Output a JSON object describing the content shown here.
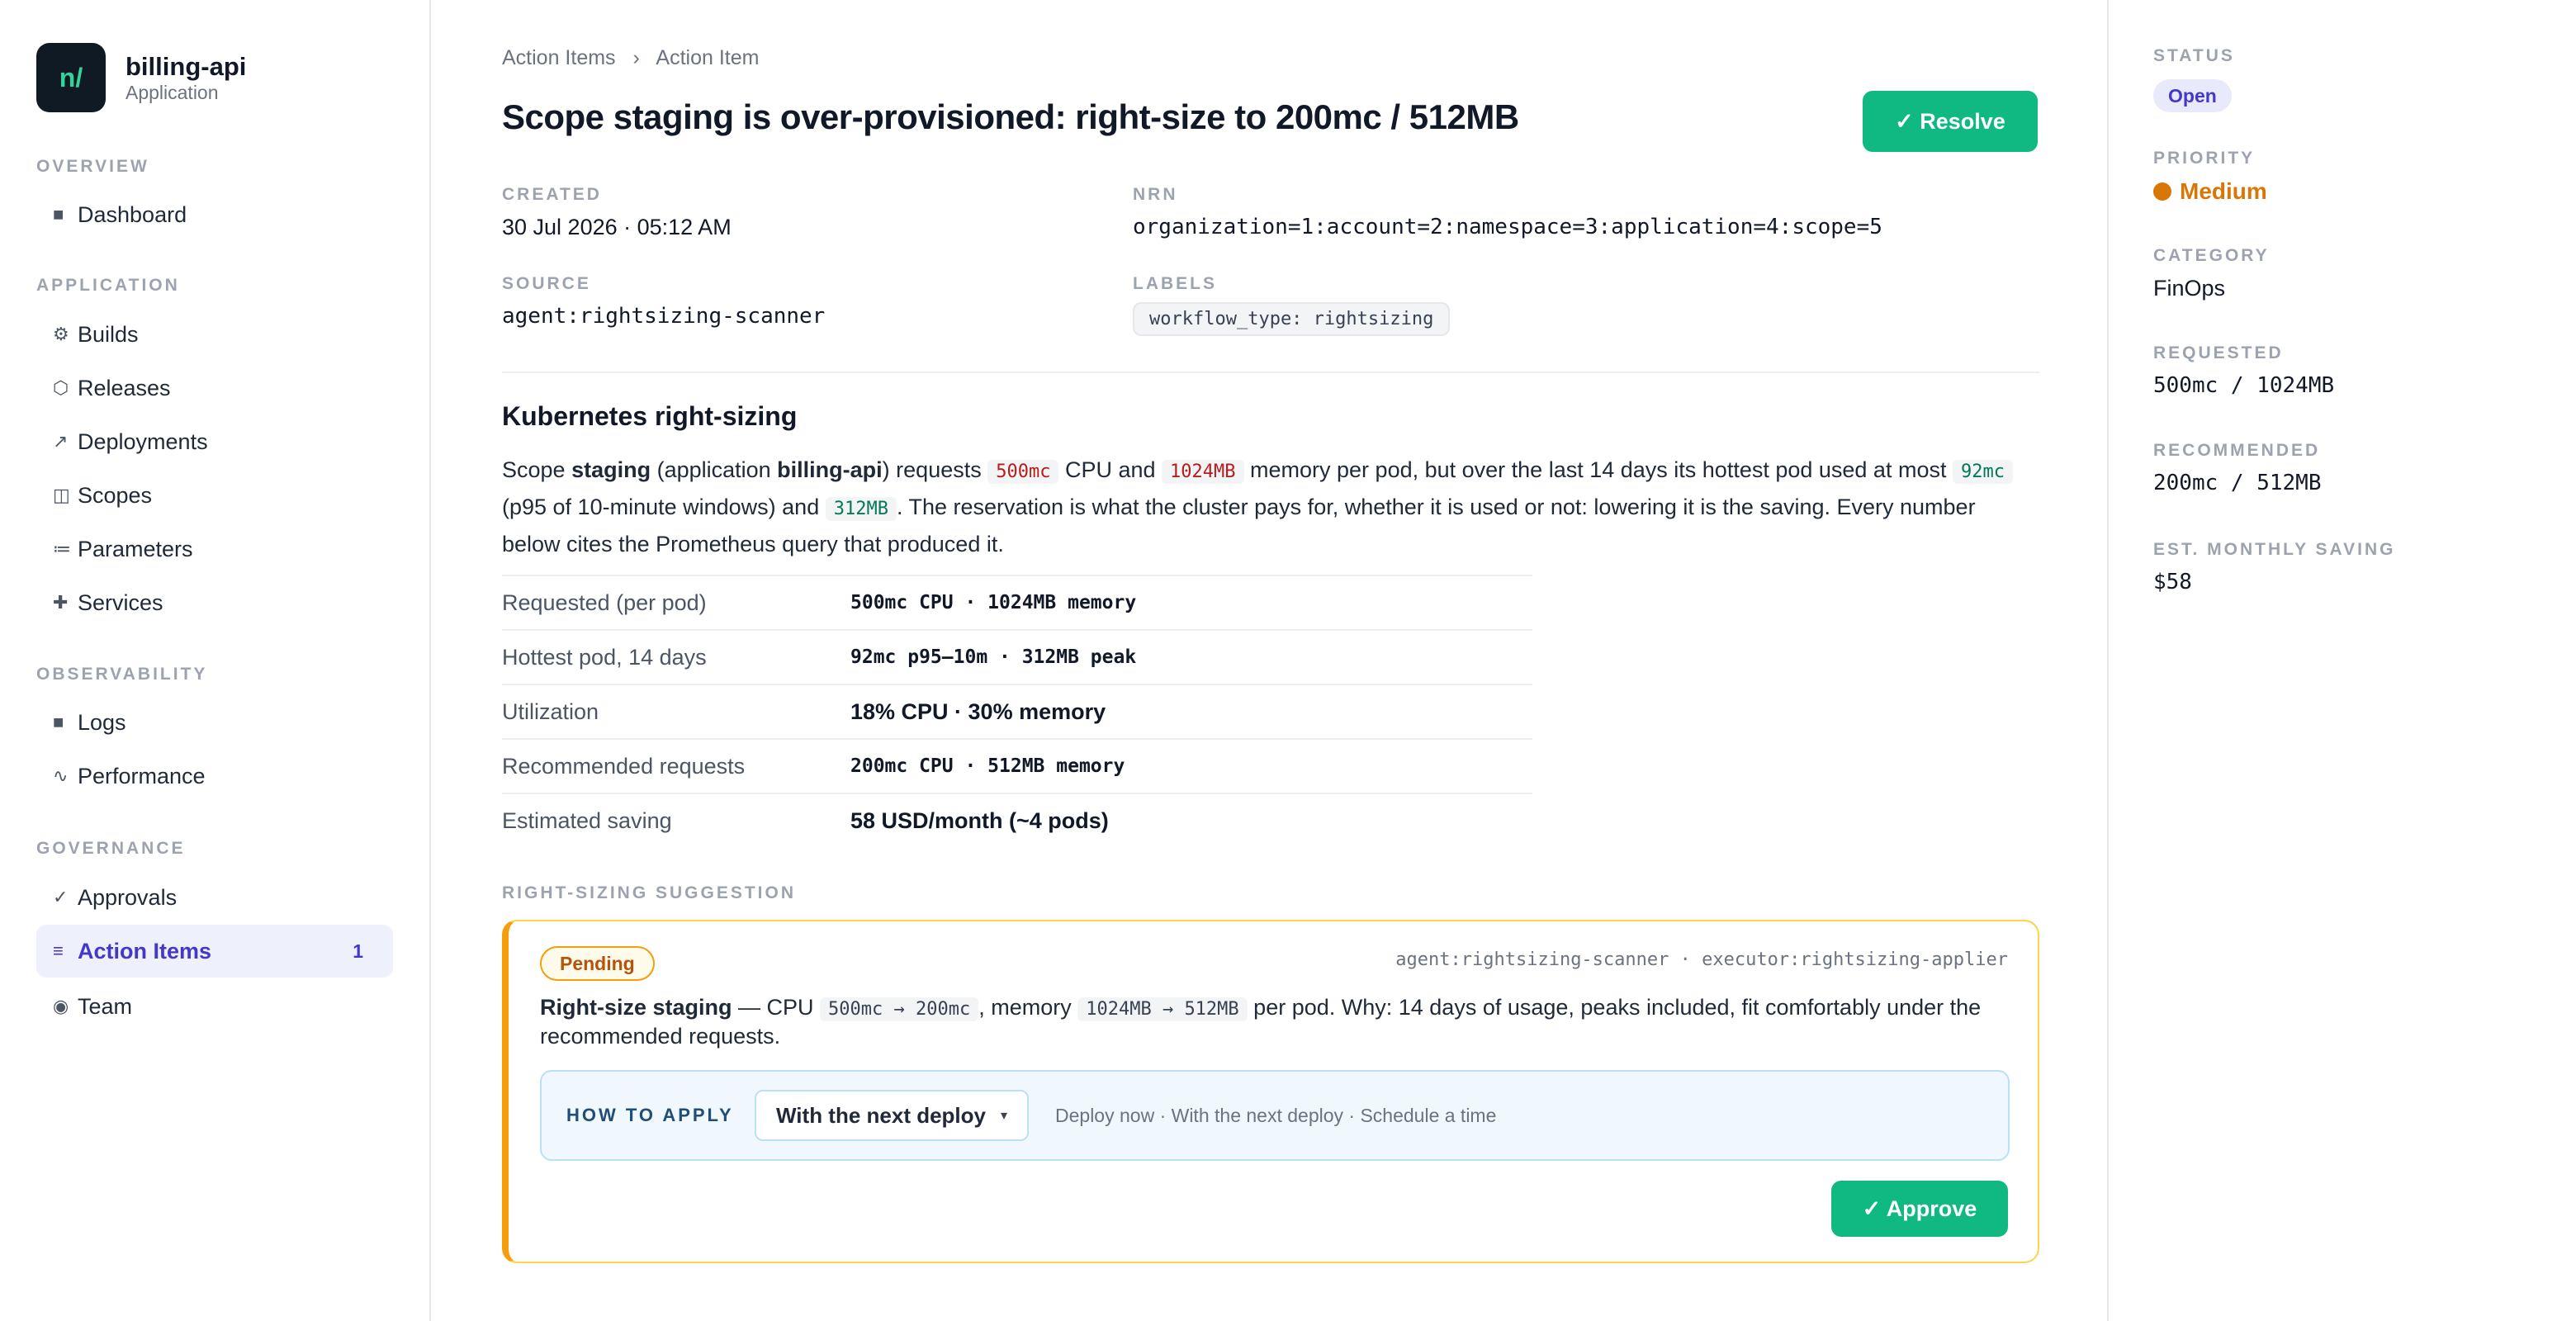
{
  "app": {
    "logo_text": "n/",
    "name": "billing-api",
    "type": "Application"
  },
  "sidebar": {
    "sections": [
      {
        "title": "OVERVIEW",
        "items": [
          {
            "icon": "square-icon",
            "glyph": "■",
            "label": "Dashboard"
          }
        ]
      },
      {
        "title": "APPLICATION",
        "items": [
          {
            "icon": "gear-icon",
            "glyph": "⚙",
            "label": "Builds"
          },
          {
            "icon": "hexagon-icon",
            "glyph": "⬡",
            "label": "Releases"
          },
          {
            "icon": "arrow-up-right-icon",
            "glyph": "↗",
            "label": "Deployments"
          },
          {
            "icon": "scopes-icon",
            "glyph": "◫",
            "label": "Scopes"
          },
          {
            "icon": "list-icon",
            "glyph": "≔",
            "label": "Parameters"
          },
          {
            "icon": "plus-icon",
            "glyph": "✚",
            "label": "Services"
          }
        ]
      },
      {
        "title": "OBSERVABILITY",
        "items": [
          {
            "icon": "square-icon",
            "glyph": "■",
            "label": "Logs"
          },
          {
            "icon": "wave-icon",
            "glyph": "∿",
            "label": "Performance"
          }
        ]
      },
      {
        "title": "GOVERNANCE",
        "items": [
          {
            "icon": "check-icon",
            "glyph": "✓",
            "label": "Approvals"
          },
          {
            "icon": "list-icon",
            "glyph": "≡",
            "label": "Action Items",
            "count": "1",
            "active": true
          },
          {
            "icon": "team-icon",
            "glyph": "◉",
            "label": "Team"
          }
        ]
      }
    ]
  },
  "breadcrumb": {
    "parent": "Action Items",
    "separator": "›",
    "current": "Action Item"
  },
  "page": {
    "title": "Scope staging is over-provisioned: right-size to 200mc / 512MB",
    "resolve_label": "✓ Resolve"
  },
  "meta": {
    "created_label": "CREATED",
    "created_value": "30 Jul 2026 · 05:12 AM",
    "nrn_label": "NRN",
    "nrn_value": "organization=1:account=2:namespace=3:application=4:scope=5",
    "source_label": "SOURCE",
    "source_value": "agent:rightsizing-scanner",
    "labels_label": "LABELS",
    "labels_value": "workflow_type: rightsizing"
  },
  "details": {
    "heading": "Kubernetes right-sizing",
    "p_1": "Scope ",
    "p_scope": "staging",
    "p_2": " (application ",
    "p_app": "billing-api",
    "p_3": ") requests ",
    "p_cpu_req": "500mc",
    "p_4": " CPU and ",
    "p_mem_req": "1024MB",
    "p_5": " memory per pod, but over the last 14 days its hottest pod used at most ",
    "p_cpu_used": "92mc",
    "p_6": " (p95 of 10-minute windows) and ",
    "p_mem_used": "312MB",
    "p_7": ". The reservation is what the cluster pays for, whether it is used or not: lowering it is the saving. Every number below cites the Prometheus query that produced it.",
    "rows": [
      {
        "key": "Requested (per pod)",
        "value": "500mc CPU · 1024MB memory",
        "mono": true
      },
      {
        "key": "Hottest pod, 14 days",
        "value": "92mc p95–10m · 312MB peak",
        "mono": true
      },
      {
        "key": "Utilization",
        "value": "18% CPU · 30% memory",
        "mono": false
      },
      {
        "key": "Recommended requests",
        "value": "200mc CPU · 512MB memory",
        "mono": true
      },
      {
        "key": "Estimated saving",
        "value": "58 USD/month (~4 pods)",
        "mono": false
      }
    ]
  },
  "suggestion": {
    "section_label": "RIGHT-SIZING SUGGESTION",
    "status": "Pending",
    "agents": "agent:rightsizing-scanner · executor:rightsizing-applier",
    "t_title": "Right-size staging",
    "t_1": " — CPU ",
    "t_cpu": "500mc → 200mc",
    "t_2": ", memory ",
    "t_mem": "1024MB → 512MB",
    "t_3": " per pod. Why: 14 days of usage, peaks included, fit comfortably under the recommended requests.",
    "how_label": "HOW TO APPLY",
    "how_selected": "With the next deploy",
    "how_caret": "▾",
    "how_options": "Deploy now · With the next deploy · Schedule a time",
    "approve_label": "✓ Approve"
  },
  "panel": {
    "status_label": "STATUS",
    "status_value": "Open",
    "priority_label": "PRIORITY",
    "priority_value": "Medium",
    "category_label": "CATEGORY",
    "category_value": "FinOps",
    "requested_label": "REQUESTED",
    "requested_value": "500mc / 1024MB",
    "recommended_label": "RECOMMENDED",
    "recommended_value": "200mc / 512MB",
    "saving_label": "EST. MONTHLY SAVING",
    "saving_value": "$58"
  },
  "colors": {
    "accent": "#4338ca",
    "success": "#10b981",
    "warning": "#f59e0b",
    "priority": "#d97706"
  }
}
